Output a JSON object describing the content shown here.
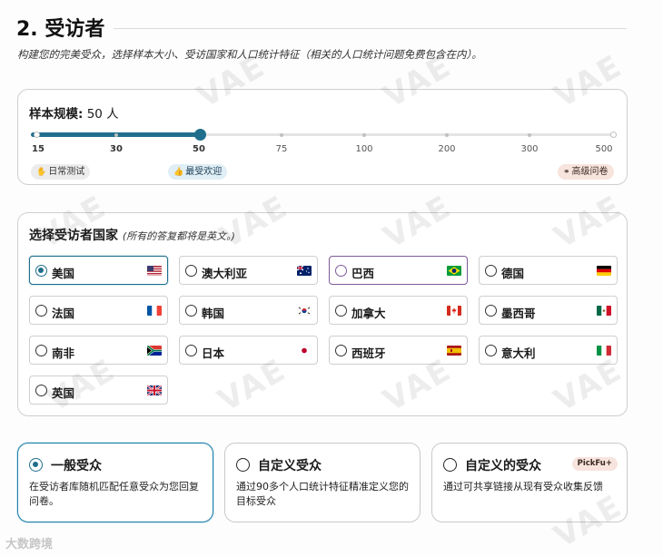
{
  "section": {
    "title": "2. 受访者",
    "subtitle": "构建您的完美受众，选择样本大小、受访国家和人口统计特征（相关的人口统计问题免费包含在内）。"
  },
  "sample": {
    "label": "样本规模:",
    "value": "50 人",
    "ticks": [
      "15",
      "30",
      "50",
      "75",
      "100",
      "200",
      "300",
      "500"
    ],
    "selected_tick": "50",
    "tags": [
      {
        "label": "日常测试",
        "icon": "hand-icon"
      },
      {
        "label": "最受欢迎",
        "icon": "thumbs-up-icon"
      },
      {
        "label": "高级问卷",
        "icon": "link-icon"
      }
    ]
  },
  "countries": {
    "heading": "选择受访者国家",
    "note": "(所有的答复都将是英文。)",
    "options": [
      {
        "label": "美国",
        "flag": "us-flag-icon",
        "selected": true
      },
      {
        "label": "澳大利亚",
        "flag": "au-flag-icon",
        "selected": false
      },
      {
        "label": "巴西",
        "flag": "br-flag-icon",
        "selected": false
      },
      {
        "label": "德国",
        "flag": "de-flag-icon",
        "selected": false
      },
      {
        "label": "法国",
        "flag": "fr-flag-icon",
        "selected": false
      },
      {
        "label": "韩国",
        "flag": "kr-flag-icon",
        "selected": false
      },
      {
        "label": "加拿大",
        "flag": "ca-flag-icon",
        "selected": false
      },
      {
        "label": "墨西哥",
        "flag": "mx-flag-icon",
        "selected": false
      },
      {
        "label": "南非",
        "flag": "za-flag-icon",
        "selected": false
      },
      {
        "label": "日本",
        "flag": "jp-flag-icon",
        "selected": false
      },
      {
        "label": "西班牙",
        "flag": "es-flag-icon",
        "selected": false
      },
      {
        "label": "意大利",
        "flag": "it-flag-icon",
        "selected": false
      },
      {
        "label": "英国",
        "flag": "gb-flag-icon",
        "selected": false
      }
    ]
  },
  "audiences": [
    {
      "title": "一般受众",
      "desc": "在受访者库随机匹配任意受众为您回复问卷。",
      "selected": true,
      "badge": ""
    },
    {
      "title": "自定义受众",
      "desc": "通过90多个人口统计特征精准定义您的目标受众",
      "selected": false,
      "badge": ""
    },
    {
      "title": "自定义的受众",
      "desc": "通过可共享链接从现有受众收集反馈",
      "selected": false,
      "badge": "PickFu+"
    }
  ],
  "watermark": "VAE",
  "corner_mark": "大数跨境",
  "colors": {
    "accent": "#1f6e8c",
    "hover_border": "#7e5a9a",
    "tag_pink": "#f7e4dc",
    "tag_blue": "#e0eef5"
  }
}
